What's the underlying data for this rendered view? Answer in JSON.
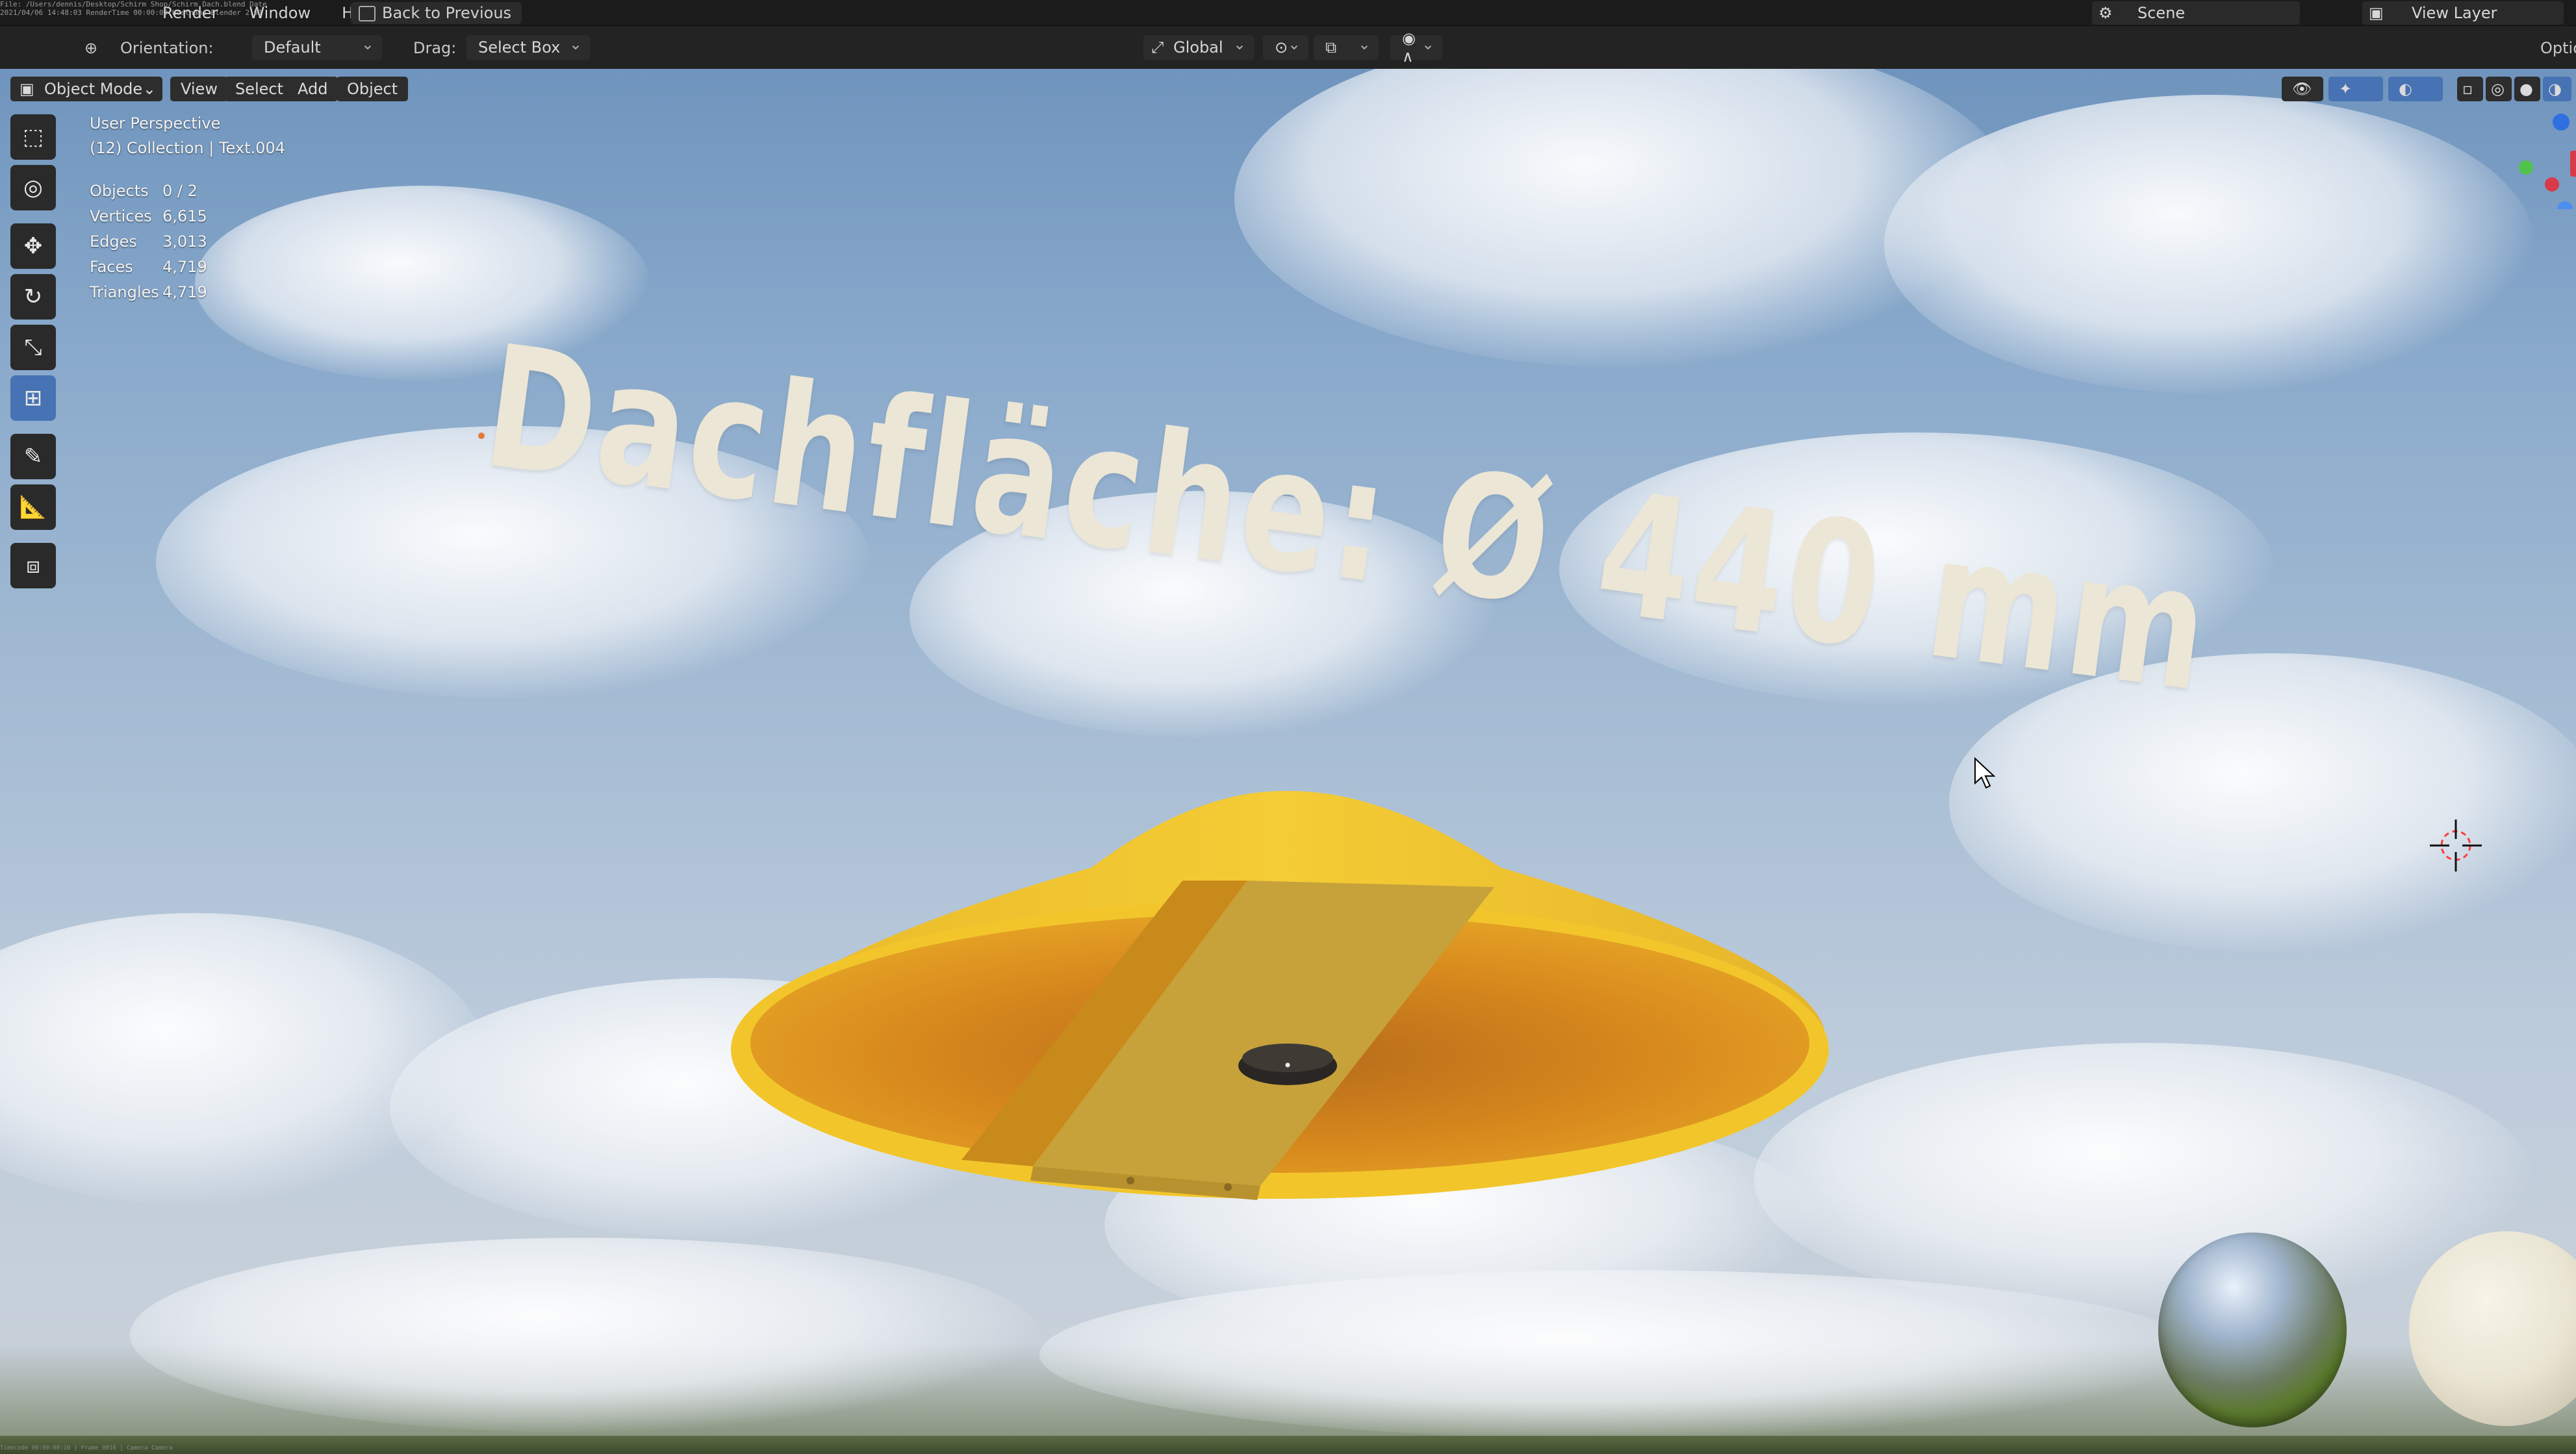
{
  "menubar": {
    "items": [
      "Render",
      "Window",
      "Help"
    ],
    "back_label": "Back to Previous",
    "render_stamp": "File: /Users/dennis/Desktop/Schirm Shop/Schirm Dach.blend  Date 2021/04/06 14:48:03  RenderTime 00:00:00  Hostname  Blender 2.91",
    "scene_label": "Scene",
    "view_layer_label": "View Layer"
  },
  "toolhdr": {
    "orientation_label": "Orientation:",
    "orientation_value": "Default",
    "drag_label": "Drag:",
    "drag_value": "Select Box",
    "transform_value": "Global",
    "options_label": "Options"
  },
  "viewport_header": {
    "mode": "Object Mode",
    "menus": [
      "View",
      "Select",
      "Add",
      "Object"
    ]
  },
  "overlay": {
    "perspective": "User Perspective",
    "collection": "(12) Collection | Text.004",
    "stats": [
      {
        "k": "Objects",
        "v": "0 / 2"
      },
      {
        "k": "Vertices",
        "v": "6,615"
      },
      {
        "k": "Edges",
        "v": "3,013"
      },
      {
        "k": "Faces",
        "v": "4,719"
      },
      {
        "k": "Triangles",
        "v": "4,719"
      }
    ]
  },
  "scene_text": "Dachfläche:  Ø 440 mm",
  "tools": [
    "select-box-icon",
    "cursor-icon",
    "move-icon",
    "rotate-icon",
    "scale-icon",
    "transform-icon",
    "annotate-icon",
    "measure-icon",
    "add-cube-icon"
  ],
  "colors": {
    "accent": "#4772b3",
    "umbrella": "#f0c51f",
    "umbrella_inner": "#d88a1a"
  },
  "statusbar": "Timecode 00:00:00:16 | Frame 0016 | Camera Camera"
}
